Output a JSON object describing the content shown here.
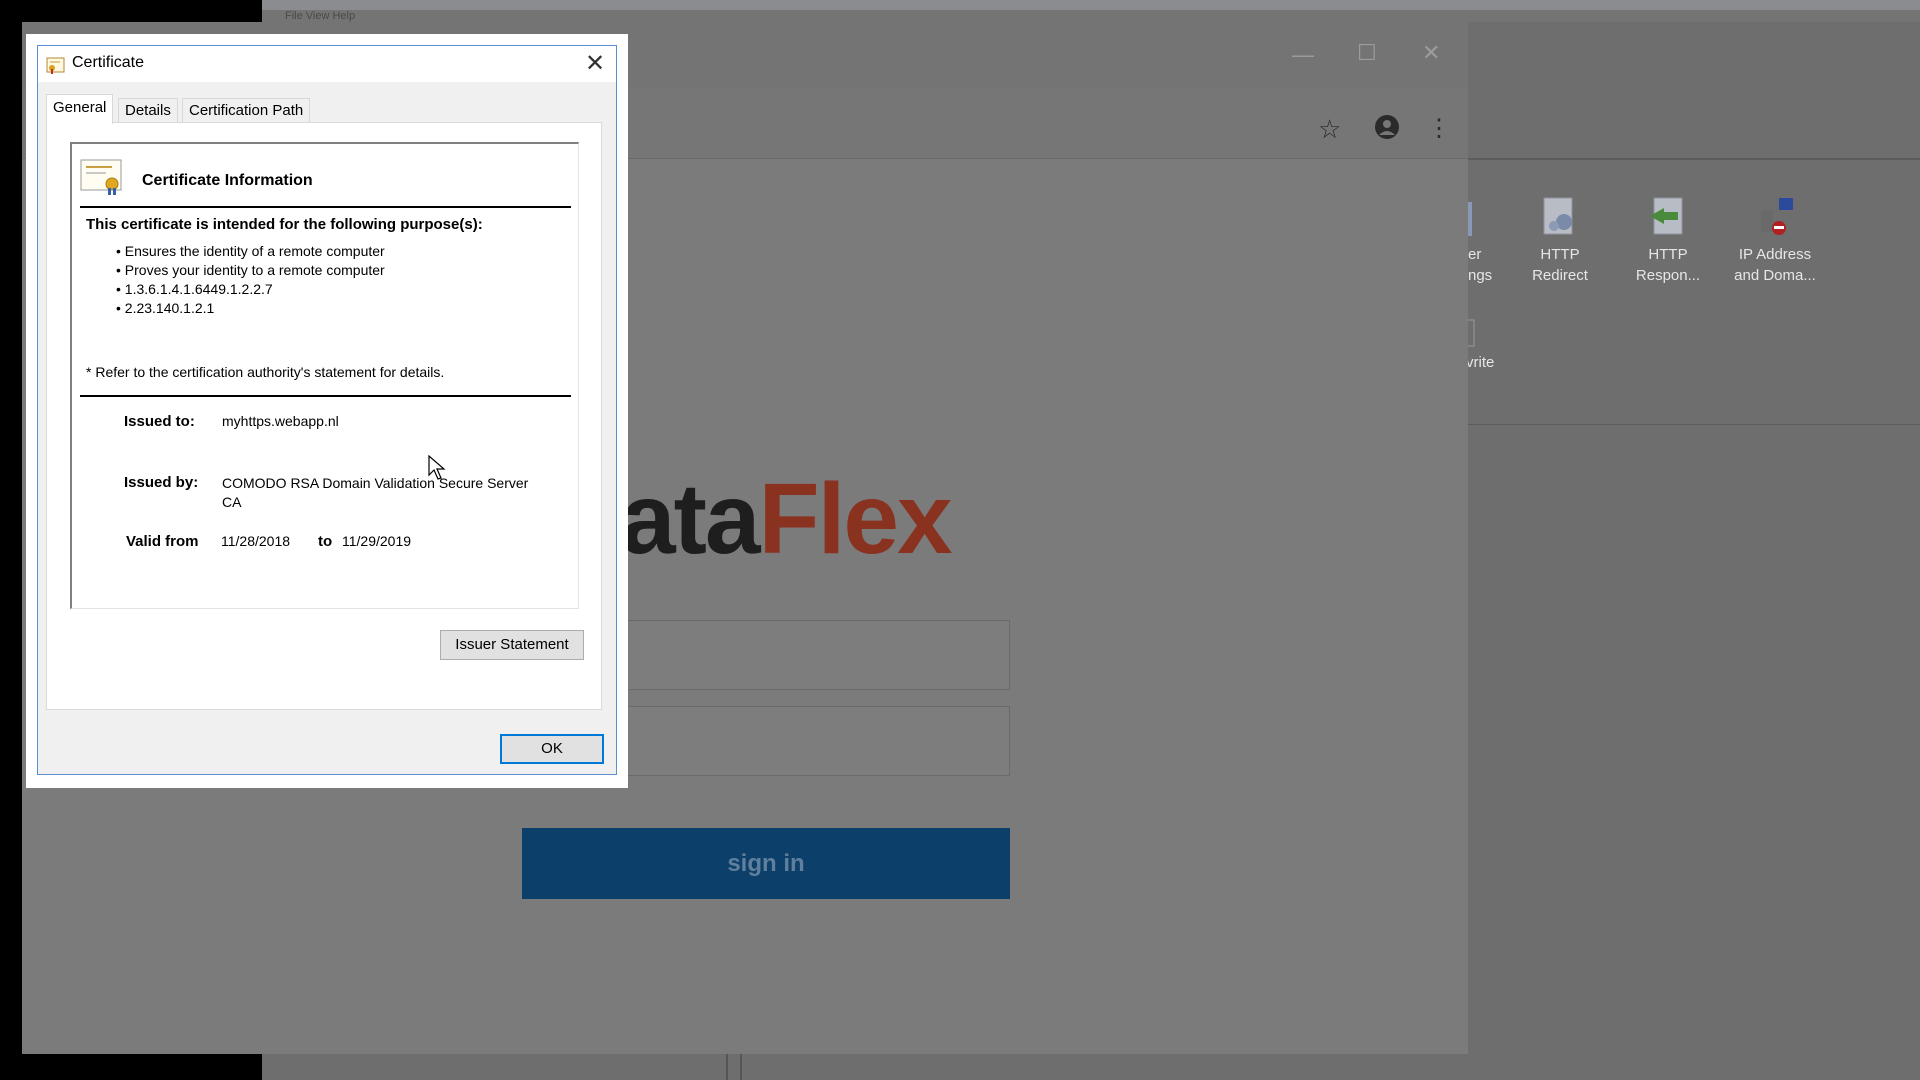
{
  "background_app": {
    "menu_text": "File   View   Help",
    "features": [
      {
        "label_line1": "er",
        "label_line2": "ngs"
      },
      {
        "label_line1": "HTTP",
        "label_line2": "Redirect"
      },
      {
        "label_line1": "HTTP",
        "label_line2": "Respon..."
      },
      {
        "label_line1": "IP Address",
        "label_line2": "and Doma..."
      }
    ],
    "rewrite_label": "vrite"
  },
  "browser": {
    "minimize_glyph": "—",
    "maximize_glyph": "☐",
    "close_glyph": "✕",
    "star_icon": "☆",
    "account_icon": "●",
    "menu_icon": "⋮"
  },
  "login": {
    "logo_part1": "ata",
    "logo_part2": "Flex",
    "signin_label": "sign in"
  },
  "dialog": {
    "title": "Certificate",
    "close_glyph": "✕",
    "tabs": [
      "General",
      "Details",
      "Certification Path"
    ],
    "info_heading": "Certificate Information",
    "purpose_heading": "This certificate is intended for the following purpose(s):",
    "purposes": [
      "Ensures the identity of a remote computer",
      "Proves your identity to a remote computer",
      "1.3.6.1.4.1.6449.1.2.2.7",
      "2.23.140.1.2.1"
    ],
    "note": "* Refer to the certification authority's statement for details.",
    "issued_to_label": "Issued to:",
    "issued_to_value": "myhttps.webapp.nl",
    "issued_by_label": "Issued by:",
    "issued_by_value_line1": "COMODO RSA Domain Validation Secure Server",
    "issued_by_value_line2": "CA",
    "valid_from_label": "Valid from",
    "valid_from_value": "11/28/2018",
    "to_label": "to",
    "valid_to_value": "11/29/2019",
    "issuer_statement_label": "Issuer Statement",
    "ok_label": "OK"
  }
}
